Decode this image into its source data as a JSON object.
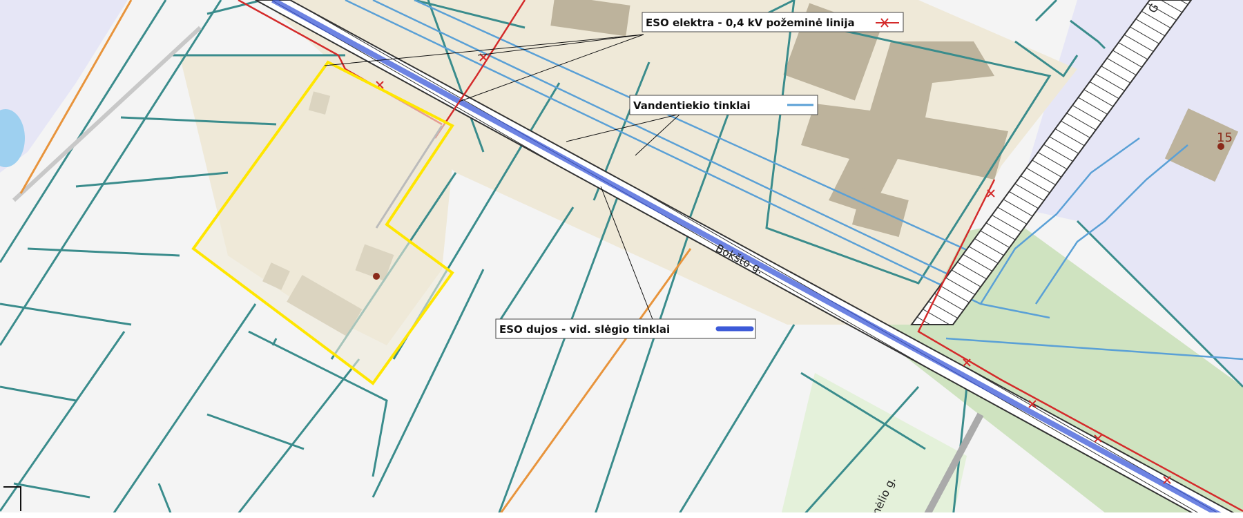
{
  "legend": {
    "electric": "ESO elektra - 0,4 kV požeminė linija",
    "water": "Vandentiekio tinklai",
    "gas": "ESO dujos - vid. slėgio tinklai"
  },
  "streets": {
    "main": "Bokšto g.",
    "side": "mėlio g.",
    "corner": "G"
  },
  "labels": {
    "house_number": "15"
  },
  "colors": {
    "parcel_outline": "#3a8c8c",
    "highlight": "#ffe600",
    "electric": "#d42a2a",
    "water": "#5aa0d6",
    "gas": "#3c5ad8",
    "road_hatch": "#333333",
    "orange_line": "#e8943c",
    "building": "#bdb39c",
    "area_fill": "#efe9d8",
    "green_area": "#cfe3c0",
    "lavender": "#e6e6f6"
  }
}
